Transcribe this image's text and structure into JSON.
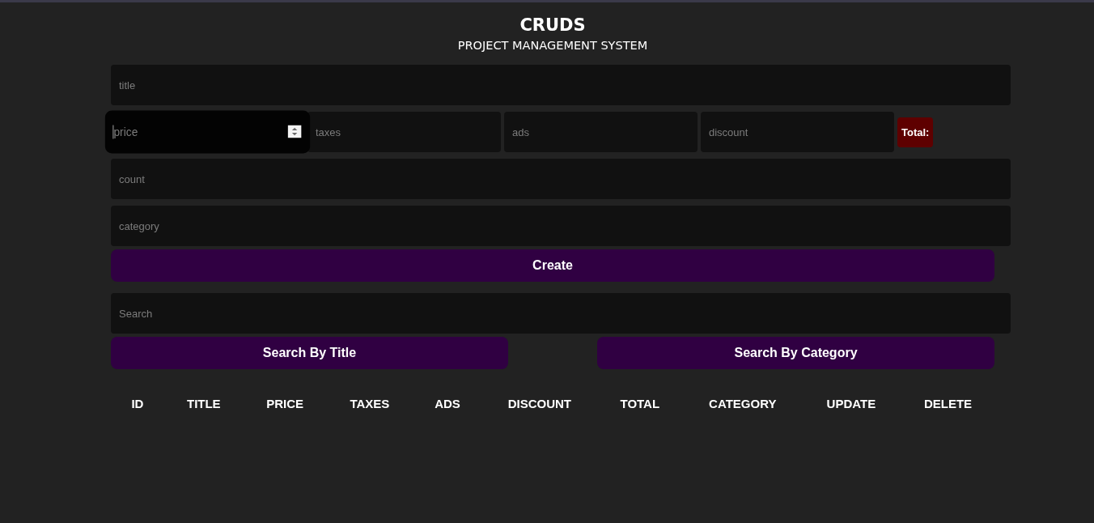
{
  "header": {
    "title": "CRUDS",
    "subtitle": "PROJECT MANAGEMENT SYSTEM"
  },
  "form": {
    "title_input": {
      "placeholder": "title"
    },
    "cost_inputs": {
      "price": {
        "placeholder": "price",
        "focused": true
      },
      "taxes": {
        "placeholder": "taxes",
        "focused": false
      },
      "ads": {
        "placeholder": "ads",
        "focused": false
      },
      "discount": {
        "placeholder": "discount",
        "focused": false
      }
    },
    "total": {
      "label": "Total:"
    },
    "count_input": {
      "placeholder": "count"
    },
    "category_input": {
      "placeholder": "category"
    },
    "create_button": {
      "label": "Create"
    }
  },
  "search": {
    "input": {
      "placeholder": "Search"
    },
    "buttons": [
      {
        "label": "Search By Title"
      },
      {
        "label": "Search By Category"
      }
    ]
  },
  "table": {
    "columns": [
      "ID",
      "TITLE",
      "PRICE",
      "TAXES",
      "ADS",
      "DISCOUNT",
      "TOTAL",
      "CATEGORY",
      "UPDATE",
      "DELETE"
    ]
  }
}
